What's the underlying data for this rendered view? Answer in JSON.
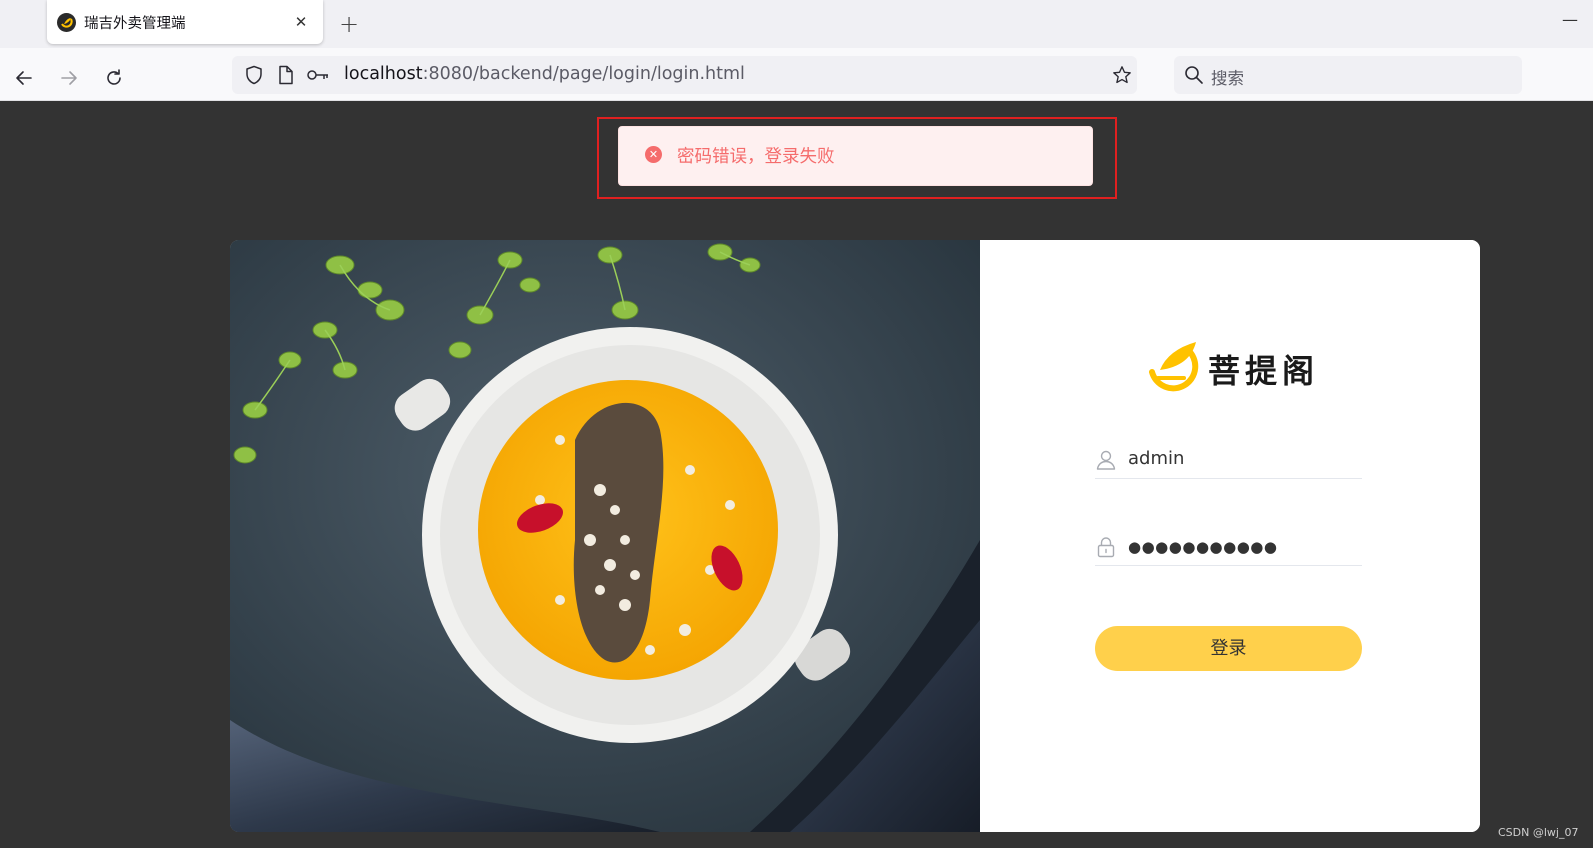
{
  "browser": {
    "tab_title": "瑞吉外卖管理端",
    "tab_close": "✕",
    "new_tab": "+",
    "minimize": "—",
    "url_host": "localhost",
    "url_rest": ":8080/backend/page/login/login.html",
    "search_placeholder": "搜索"
  },
  "message": {
    "type": "error",
    "icon": "✕",
    "text": "密码错误，登录失败",
    "color": "#f56c6c"
  },
  "login": {
    "brand_name": "菩提阁",
    "username": "admin",
    "password_masked": "●●●●●●●●●●●",
    "button_label": "登录",
    "button_color": "#ffd04b"
  },
  "watermark": "CSDN @lwj_07"
}
